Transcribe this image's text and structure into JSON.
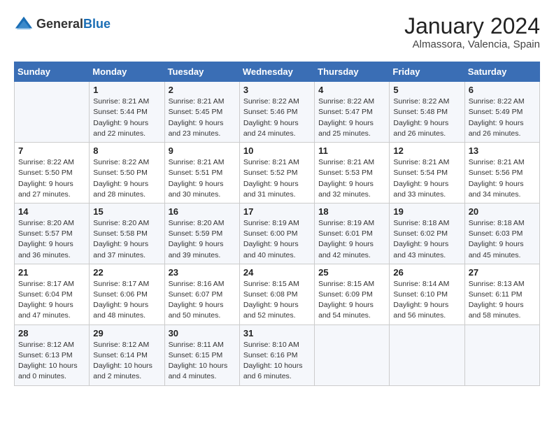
{
  "header": {
    "logo_general": "General",
    "logo_blue": "Blue",
    "month_title": "January 2024",
    "subtitle": "Almassora, Valencia, Spain"
  },
  "weekdays": [
    "Sunday",
    "Monday",
    "Tuesday",
    "Wednesday",
    "Thursday",
    "Friday",
    "Saturday"
  ],
  "weeks": [
    [
      {
        "day": "",
        "info": ""
      },
      {
        "day": "1",
        "info": "Sunrise: 8:21 AM\nSunset: 5:44 PM\nDaylight: 9 hours\nand 22 minutes."
      },
      {
        "day": "2",
        "info": "Sunrise: 8:21 AM\nSunset: 5:45 PM\nDaylight: 9 hours\nand 23 minutes."
      },
      {
        "day": "3",
        "info": "Sunrise: 8:22 AM\nSunset: 5:46 PM\nDaylight: 9 hours\nand 24 minutes."
      },
      {
        "day": "4",
        "info": "Sunrise: 8:22 AM\nSunset: 5:47 PM\nDaylight: 9 hours\nand 25 minutes."
      },
      {
        "day": "5",
        "info": "Sunrise: 8:22 AM\nSunset: 5:48 PM\nDaylight: 9 hours\nand 26 minutes."
      },
      {
        "day": "6",
        "info": "Sunrise: 8:22 AM\nSunset: 5:49 PM\nDaylight: 9 hours\nand 26 minutes."
      }
    ],
    [
      {
        "day": "7",
        "info": "Sunrise: 8:22 AM\nSunset: 5:50 PM\nDaylight: 9 hours\nand 27 minutes."
      },
      {
        "day": "8",
        "info": "Sunrise: 8:22 AM\nSunset: 5:50 PM\nDaylight: 9 hours\nand 28 minutes."
      },
      {
        "day": "9",
        "info": "Sunrise: 8:21 AM\nSunset: 5:51 PM\nDaylight: 9 hours\nand 30 minutes."
      },
      {
        "day": "10",
        "info": "Sunrise: 8:21 AM\nSunset: 5:52 PM\nDaylight: 9 hours\nand 31 minutes."
      },
      {
        "day": "11",
        "info": "Sunrise: 8:21 AM\nSunset: 5:53 PM\nDaylight: 9 hours\nand 32 minutes."
      },
      {
        "day": "12",
        "info": "Sunrise: 8:21 AM\nSunset: 5:54 PM\nDaylight: 9 hours\nand 33 minutes."
      },
      {
        "day": "13",
        "info": "Sunrise: 8:21 AM\nSunset: 5:56 PM\nDaylight: 9 hours\nand 34 minutes."
      }
    ],
    [
      {
        "day": "14",
        "info": "Sunrise: 8:20 AM\nSunset: 5:57 PM\nDaylight: 9 hours\nand 36 minutes."
      },
      {
        "day": "15",
        "info": "Sunrise: 8:20 AM\nSunset: 5:58 PM\nDaylight: 9 hours\nand 37 minutes."
      },
      {
        "day": "16",
        "info": "Sunrise: 8:20 AM\nSunset: 5:59 PM\nDaylight: 9 hours\nand 39 minutes."
      },
      {
        "day": "17",
        "info": "Sunrise: 8:19 AM\nSunset: 6:00 PM\nDaylight: 9 hours\nand 40 minutes."
      },
      {
        "day": "18",
        "info": "Sunrise: 8:19 AM\nSunset: 6:01 PM\nDaylight: 9 hours\nand 42 minutes."
      },
      {
        "day": "19",
        "info": "Sunrise: 8:18 AM\nSunset: 6:02 PM\nDaylight: 9 hours\nand 43 minutes."
      },
      {
        "day": "20",
        "info": "Sunrise: 8:18 AM\nSunset: 6:03 PM\nDaylight: 9 hours\nand 45 minutes."
      }
    ],
    [
      {
        "day": "21",
        "info": "Sunrise: 8:17 AM\nSunset: 6:04 PM\nDaylight: 9 hours\nand 47 minutes."
      },
      {
        "day": "22",
        "info": "Sunrise: 8:17 AM\nSunset: 6:06 PM\nDaylight: 9 hours\nand 48 minutes."
      },
      {
        "day": "23",
        "info": "Sunrise: 8:16 AM\nSunset: 6:07 PM\nDaylight: 9 hours\nand 50 minutes."
      },
      {
        "day": "24",
        "info": "Sunrise: 8:15 AM\nSunset: 6:08 PM\nDaylight: 9 hours\nand 52 minutes."
      },
      {
        "day": "25",
        "info": "Sunrise: 8:15 AM\nSunset: 6:09 PM\nDaylight: 9 hours\nand 54 minutes."
      },
      {
        "day": "26",
        "info": "Sunrise: 8:14 AM\nSunset: 6:10 PM\nDaylight: 9 hours\nand 56 minutes."
      },
      {
        "day": "27",
        "info": "Sunrise: 8:13 AM\nSunset: 6:11 PM\nDaylight: 9 hours\nand 58 minutes."
      }
    ],
    [
      {
        "day": "28",
        "info": "Sunrise: 8:12 AM\nSunset: 6:13 PM\nDaylight: 10 hours\nand 0 minutes."
      },
      {
        "day": "29",
        "info": "Sunrise: 8:12 AM\nSunset: 6:14 PM\nDaylight: 10 hours\nand 2 minutes."
      },
      {
        "day": "30",
        "info": "Sunrise: 8:11 AM\nSunset: 6:15 PM\nDaylight: 10 hours\nand 4 minutes."
      },
      {
        "day": "31",
        "info": "Sunrise: 8:10 AM\nSunset: 6:16 PM\nDaylight: 10 hours\nand 6 minutes."
      },
      {
        "day": "",
        "info": ""
      },
      {
        "day": "",
        "info": ""
      },
      {
        "day": "",
        "info": ""
      }
    ]
  ]
}
